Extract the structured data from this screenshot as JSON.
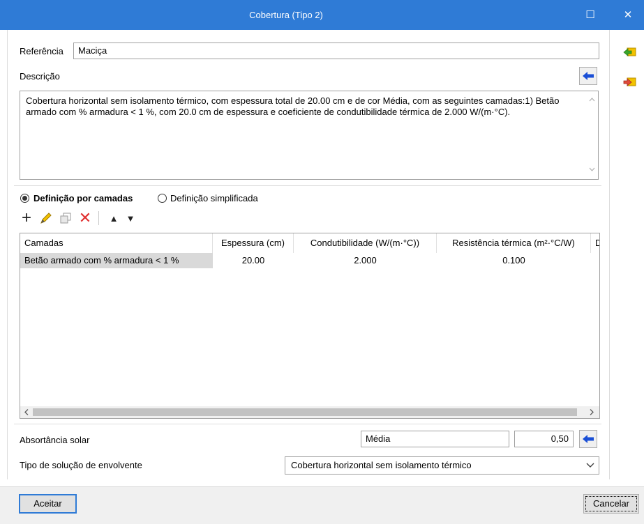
{
  "window": {
    "title": "Cobertura (Tipo 2)",
    "maximize_glyph": "☐",
    "close_glyph": "✕"
  },
  "referencia": {
    "label": "Referência",
    "value": "Maciça"
  },
  "descricao": {
    "label": "Descrição",
    "text": "Cobertura horizontal sem isolamento térmico, com espessura total de 20.00 cm e de cor Média, com as seguintes camadas:1) Betão armado com % armadura < 1 %, com 20.0 cm de espessura e coeficiente de condutibilidade térmica de 2.000 W/(m·°C)."
  },
  "definition": {
    "option1": "Definição por camadas",
    "option2": "Definição simplificada",
    "selected": "option1"
  },
  "toolbar": {
    "icons": [
      "plus-icon",
      "pencil-icon",
      "copy-icon",
      "delete-icon",
      "move-up-icon",
      "move-down-icon"
    ],
    "plus": "+",
    "delete": "✕",
    "up": "▲",
    "down": "▼"
  },
  "table": {
    "columns": [
      "Camadas",
      "Espessura (cm)",
      "Condutibilidade (W/(m·°C))",
      "Resistência térmica (m²·°C/W)",
      "D"
    ],
    "rows": [
      [
        "Betão armado com % armadura < 1 %",
        "20.00",
        "2.000",
        "0.100"
      ]
    ]
  },
  "absortancia": {
    "label": "Absortância solar",
    "category": "Média",
    "value": "0,50"
  },
  "tipo_solucao": {
    "label": "Tipo de solução de envolvente",
    "value": "Cobertura horizontal sem isolamento térmico"
  },
  "buttons": {
    "accept": "Aceitar",
    "cancel": "Cancelar"
  },
  "side_icons": [
    "import-arrow-icon",
    "export-arrow-icon"
  ],
  "colors": {
    "titlebar": "#2f7bd6",
    "arrow_blue": "#1a4fd6",
    "delete_red": "#e03030",
    "pencil_yellow": "#f2c200"
  }
}
